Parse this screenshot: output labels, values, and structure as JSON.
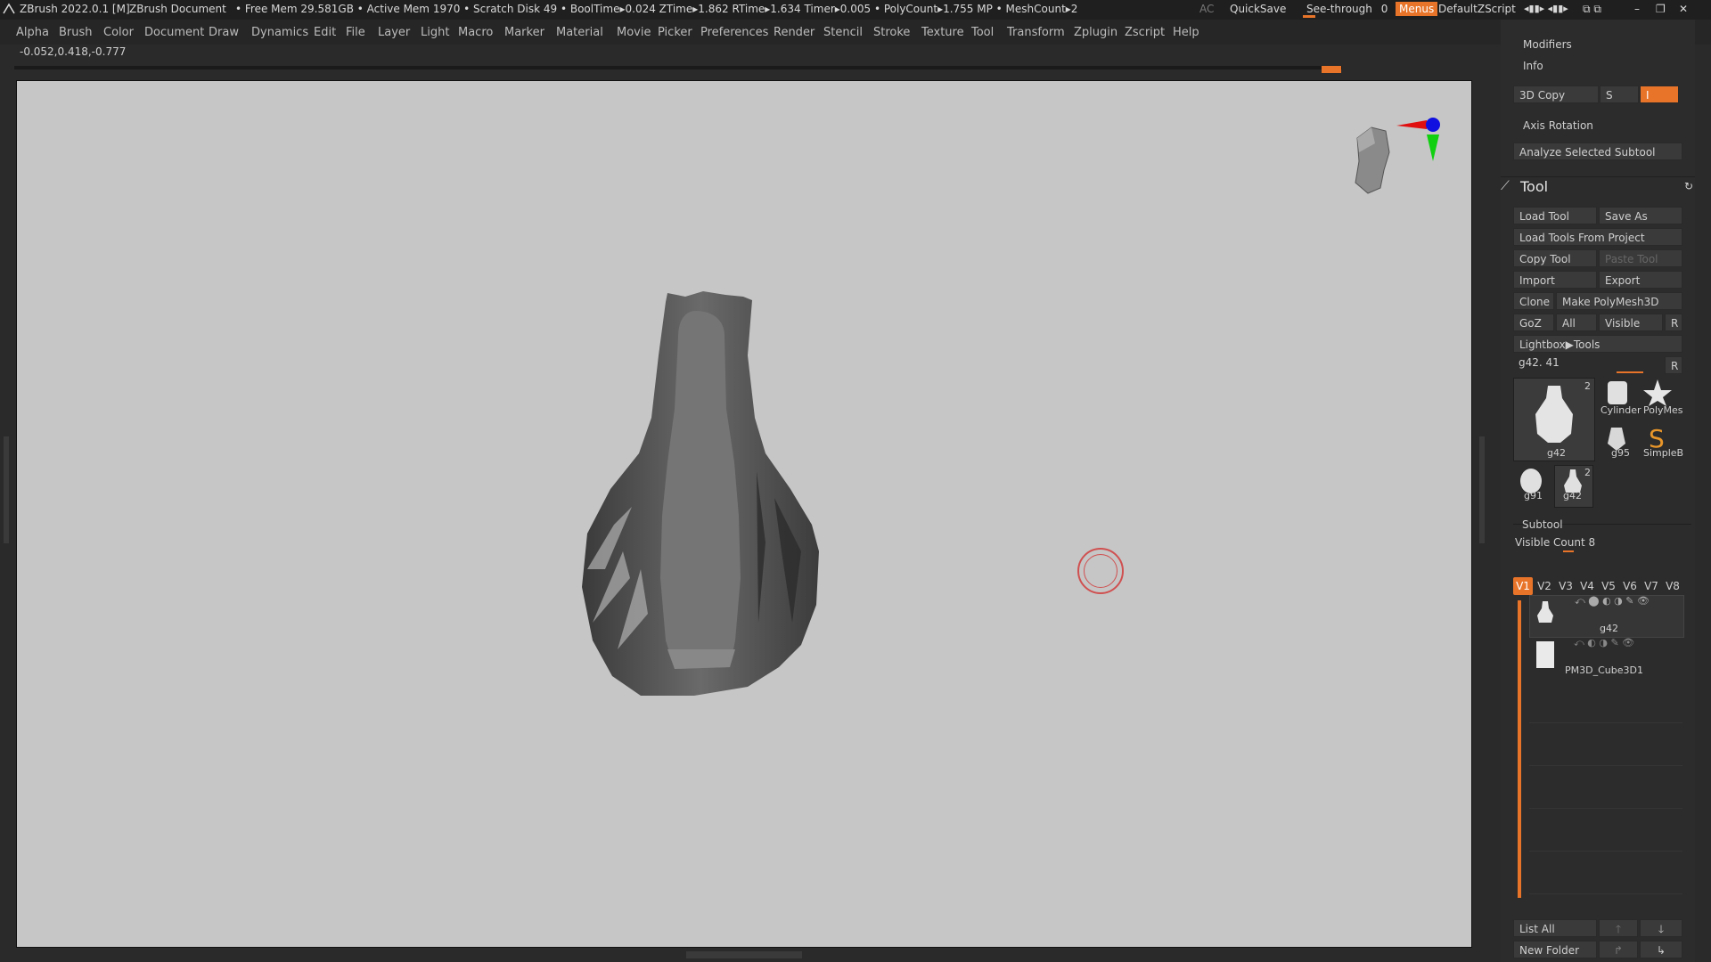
{
  "title_bar": {
    "app": "ZBrush 2022.0.1 [M]",
    "document": "ZBrush Document",
    "stats": "• Free Mem 29.581GB • Active Mem 1970 • Scratch Disk 49 •  BoolTime▸0.024 ZTime▸1.862 RTime▸1.634 Timer▸0.005 • PolyCount▸1.755 MP  • MeshCount▸2",
    "ac": "AC",
    "quicksave": "QuickSave",
    "see_through_label": "See-through",
    "see_through_value": "0",
    "menus": "Menus",
    "default_zscript": "DefaultZScript"
  },
  "menu": [
    "Alpha",
    "Brush",
    "Color",
    "Document",
    "Draw",
    "Dynamics",
    "Edit",
    "File",
    "Layer",
    "Light",
    "Macro",
    "Marker",
    "Material",
    "Movie",
    "Picker",
    "Preferences",
    "Render",
    "Stencil",
    "Stroke",
    "Texture",
    "Tool",
    "Transform",
    "Zplugin",
    "Zscript",
    "Help"
  ],
  "coords": "-0.052,0.418,-0.777",
  "panel": {
    "modifiers": "Modifiers",
    "info": "Info",
    "copy3d": "3D Copy",
    "copy_s": "S",
    "copy_field": "I",
    "axis_rotation": "Axis Rotation",
    "analyze": "Analyze Selected Subtool",
    "tool_title": "Tool",
    "load_tool": "Load Tool",
    "save_as": "Save As",
    "load_from_project": "Load Tools From Project",
    "copy_tool": "Copy Tool",
    "paste_tool": "Paste Tool",
    "import": "Import",
    "export": "Export",
    "clone": "Clone",
    "make_polymesh": "Make PolyMesh3D",
    "goz": "GoZ",
    "all": "All",
    "visible": "Visible",
    "r": "R",
    "lightbox_tools": "Lightbox▶Tools",
    "current_tool": "g42. 41",
    "tools": [
      {
        "label": "g42",
        "badge": "2"
      },
      {
        "label": "Cylinder",
        "badge": ""
      },
      {
        "label": "PolyMes",
        "badge": ""
      },
      {
        "label": "g95",
        "badge": ""
      },
      {
        "label": "SimpleB",
        "badge": ""
      },
      {
        "label": "g91",
        "badge": ""
      },
      {
        "label": "g42",
        "badge": "2"
      }
    ],
    "subtool": "Subtool",
    "visible_count": "Visible Count 8",
    "vtabs": [
      "V1",
      "V2",
      "V3",
      "V4",
      "V5",
      "V6",
      "V7",
      "V8"
    ],
    "subtools": [
      "g42",
      "PM3D_Cube3D1"
    ],
    "list_all": "List All",
    "new_folder": "New Folder"
  },
  "colors": {
    "accent": "#e8742a",
    "canvas": "#c6c6c6"
  }
}
